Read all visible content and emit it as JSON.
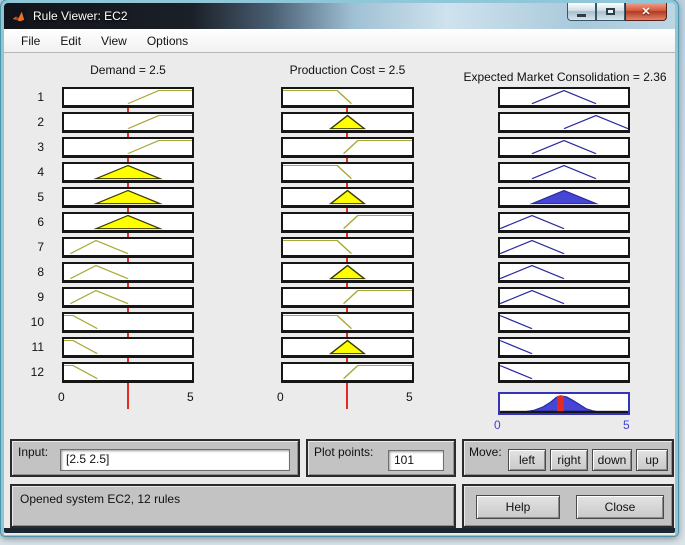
{
  "window": {
    "title": "Rule Viewer: EC2",
    "icons": {
      "app": "matlab-logo",
      "close_glyph": "x"
    }
  },
  "menu": {
    "items": [
      "File",
      "Edit",
      "View",
      "Options"
    ]
  },
  "columns": [
    {
      "header": "Demand = 2.5",
      "axis_min": "0",
      "axis_max": "5",
      "input_value": "2.5"
    },
    {
      "header": "Production Cost = 2.5",
      "axis_min": "0",
      "axis_max": "5",
      "input_value": "2.5"
    },
    {
      "header": "Expected Market Consolidation = 2.36",
      "axis_min": "0",
      "axis_max": "5",
      "output_value": "2.36"
    }
  ],
  "colors": {
    "input_line": "#a8a838",
    "input_fill": "#ffff00",
    "input_fill_stroke": "#3c3c00",
    "output_line": "#2b2ba0",
    "output_fill": "#4545d6",
    "crisp_line": "#e32b24"
  },
  "mf_shapes": {
    "demand": {
      "high": [
        [
          2.5,
          0
        ],
        [
          3.7,
          1
        ],
        [
          5,
          1
        ]
      ],
      "med": [
        [
          1.25,
          0
        ],
        [
          2.5,
          1
        ],
        [
          3.75,
          0
        ]
      ],
      "lowmid": [
        [
          0.25,
          0
        ],
        [
          1.25,
          1
        ],
        [
          2.5,
          0
        ]
      ],
      "low": [
        [
          0,
          1
        ],
        [
          0.35,
          1
        ],
        [
          1.3,
          0
        ]
      ]
    },
    "cost": {
      "low": [
        [
          0,
          1
        ],
        [
          2.1,
          1
        ],
        [
          2.65,
          0
        ]
      ],
      "mid": [
        [
          1.85,
          0
        ],
        [
          2.5,
          1
        ],
        [
          3.15,
          0
        ]
      ],
      "high": [
        [
          2.35,
          0
        ],
        [
          2.9,
          1
        ],
        [
          5,
          1
        ]
      ]
    },
    "output": {
      "mid": [
        [
          1.25,
          0
        ],
        [
          2.5,
          1
        ],
        [
          3.75,
          0
        ]
      ],
      "high": [
        [
          2.5,
          0
        ],
        [
          3.75,
          1
        ],
        [
          5,
          0
        ]
      ],
      "lowmid": [
        [
          0,
          0
        ],
        [
          1.25,
          1
        ],
        [
          2.5,
          0
        ]
      ],
      "low": [
        [
          0,
          1
        ],
        [
          1.25,
          0
        ]
      ]
    }
  },
  "rules": {
    "count": 12,
    "rows": [
      {
        "n": "1",
        "demand": "high",
        "demand_fired": false,
        "cost": "low",
        "cost_fired": false,
        "output": "mid",
        "output_fired": false
      },
      {
        "n": "2",
        "demand": "high",
        "demand_fired": false,
        "cost": "mid",
        "cost_fired": true,
        "output": "high",
        "output_fired": false
      },
      {
        "n": "3",
        "demand": "high",
        "demand_fired": false,
        "cost": "high",
        "cost_fired": false,
        "output": "mid",
        "output_fired": false
      },
      {
        "n": "4",
        "demand": "med",
        "demand_fired": true,
        "cost": "low",
        "cost_fired": false,
        "output": "mid",
        "output_fired": false
      },
      {
        "n": "5",
        "demand": "med",
        "demand_fired": true,
        "cost": "mid",
        "cost_fired": true,
        "output": "mid",
        "output_fired": true
      },
      {
        "n": "6",
        "demand": "med",
        "demand_fired": true,
        "cost": "high",
        "cost_fired": false,
        "output": "lowmid",
        "output_fired": false
      },
      {
        "n": "7",
        "demand": "lowmid",
        "demand_fired": false,
        "cost": "low",
        "cost_fired": false,
        "output": "lowmid",
        "output_fired": false
      },
      {
        "n": "8",
        "demand": "lowmid",
        "demand_fired": false,
        "cost": "mid",
        "cost_fired": true,
        "output": "lowmid",
        "output_fired": false
      },
      {
        "n": "9",
        "demand": "lowmid",
        "demand_fired": false,
        "cost": "high",
        "cost_fired": false,
        "output": "lowmid",
        "output_fired": false
      },
      {
        "n": "10",
        "demand": "low",
        "demand_fired": false,
        "cost": "low",
        "cost_fired": false,
        "output": "low",
        "output_fired": false
      },
      {
        "n": "11",
        "demand": "low",
        "demand_fired": false,
        "cost": "mid",
        "cost_fired": true,
        "output": "low",
        "output_fired": false
      },
      {
        "n": "12",
        "demand": "low",
        "demand_fired": false,
        "cost": "high",
        "cost_fired": false,
        "output": "low",
        "output_fired": false
      }
    ]
  },
  "aggregate": {
    "points": [
      [
        1.05,
        0
      ],
      [
        1.35,
        0.08
      ],
      [
        1.7,
        0.3
      ],
      [
        2.0,
        0.62
      ],
      [
        2.2,
        0.9
      ],
      [
        2.36,
        1
      ],
      [
        2.6,
        0.93
      ],
      [
        2.85,
        0.7
      ],
      [
        3.1,
        0.45
      ],
      [
        3.35,
        0.18
      ],
      [
        3.6,
        0.05
      ],
      [
        3.75,
        0
      ]
    ],
    "crisp_x": 2.36
  },
  "controls": {
    "input_label": "Input:",
    "input_value": "[2.5 2.5]",
    "plot_points_label": "Plot points:",
    "plot_points_value": "101",
    "move_label": "Move:",
    "move_buttons": [
      "left",
      "right",
      "down",
      "up"
    ],
    "help_label": "Help",
    "close_label": "Close"
  },
  "status": {
    "text": "Opened system EC2, 12 rules"
  }
}
